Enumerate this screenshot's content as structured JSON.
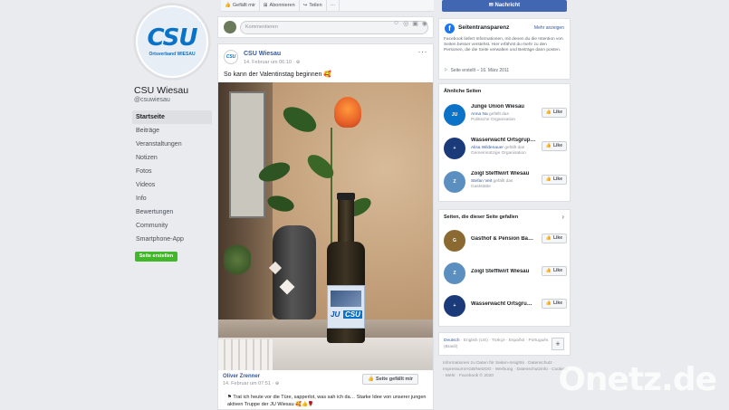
{
  "page": {
    "logo_text": "CSU",
    "logo_sub": "Ortsverband WIESAU",
    "name": "CSU Wiesau",
    "handle": "@csuwiesau",
    "create_button": "Seite erstellen"
  },
  "nav": [
    {
      "label": "Startseite"
    },
    {
      "label": "Beiträge"
    },
    {
      "label": "Veranstaltungen"
    },
    {
      "label": "Notizen"
    },
    {
      "label": "Fotos"
    },
    {
      "label": "Videos"
    },
    {
      "label": "Info"
    },
    {
      "label": "Bewertungen"
    },
    {
      "label": "Community"
    },
    {
      "label": "Smartphone-App"
    }
  ],
  "top_actions": {
    "liked": "Gefällt mir",
    "subscribe": "Abonnieren",
    "share": "Teilen",
    "more": "···"
  },
  "comment": {
    "placeholder": "Kommentieren"
  },
  "post": {
    "author": "CSU Wiesau",
    "time": "14. Februar um 06:10 · ",
    "text": "So kann der Valentinstag beginnen 🥰",
    "more": "···",
    "image_label_ju": "JU",
    "image_label_csu": "CSU"
  },
  "shared": {
    "author": "Oliver Zrenner",
    "time": "14. Februar um 07:51 · ",
    "like_button": "Seite gefällt mir",
    "text": "Trat ich heute vor die Türe, sapperlot, was sah ich da… Starke Idee von unserer jungen aktiven Truppe der JU Wiesau 🥰👍🌹"
  },
  "right": {
    "message_button": "Nachricht",
    "transparency": {
      "title": "Seitentransparenz",
      "more": "Mehr anzeigen",
      "text": "Facebook liefert Informationen, mit denen du die Intention von Seiten besser verstehst. Hier erfährst du mehr zu den Personen, die die Seite verwalten und Beiträge dann posten.",
      "created": "Seite erstellt – 16. März 2011"
    },
    "similar_title": "Ähnliche Seiten",
    "similar": [
      {
        "name": "Junge Union Wiesau",
        "hl": "Anna Na",
        "rest": " gefällt das",
        "sub2": "Politische Organisation",
        "like": "Like",
        "color": "#0a72c7",
        "abbr": "JU"
      },
      {
        "name": "Wasserwacht Ortsgrup…",
        "hl": "Alisa Wildenauer",
        "rest": " gefällt das",
        "sub2": "Gemeinnützige Organisation",
        "like": "Like",
        "color": "#1b3a7a",
        "abbr": "+"
      },
      {
        "name": "Zoigl Stefflwirt Wiesau",
        "hl": "Stefan Veit",
        "rest": " gefällt das",
        "sub2": "Gaststätte",
        "like": "Like",
        "color": "#5b8fc0",
        "abbr": "Z"
      }
    ],
    "liked_title": "Seiten, die dieser Seite gefallen",
    "liked_pages": [
      {
        "name": "Gasthof & Pension Ba…",
        "like": "Like",
        "color": "#8a6a30",
        "abbr": "G"
      },
      {
        "name": "Zoigl Stefflwirt Wiesau",
        "like": "Like",
        "color": "#5b8fc0",
        "abbr": "Z"
      },
      {
        "name": "Wasserwacht Ortsgru…",
        "like": "Like",
        "color": "#1b3a7a",
        "abbr": "+"
      }
    ],
    "languages": {
      "current": "Deutsch",
      "others": " · English (US) · Türkçe · Español · Português (Brasil)",
      "plus": "+"
    },
    "footer": "Informationen zu Daten für Seiten-Insights · Datenschutz · Impressum/AGB/NetzDG · Werbung · Datenschutzinfo · Cookies · Mehr · Facebook © 2020"
  },
  "watermark": "Onetz.de",
  "colors": {
    "brand": "#4267b2",
    "csu_blue": "#0a72c7",
    "link": "#365899",
    "green": "#42b72a"
  }
}
